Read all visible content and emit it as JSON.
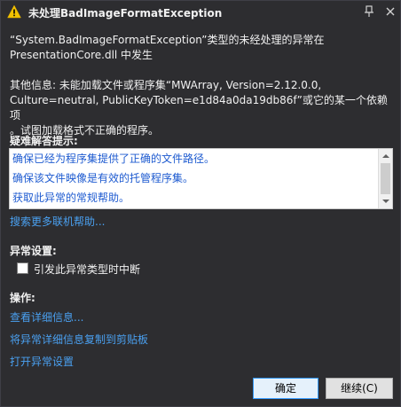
{
  "window": {
    "title": "未处理BadImageFormatException",
    "title_icon": "warning-icon",
    "pin_icon": "pin-icon",
    "close_icon": "close-icon"
  },
  "message": {
    "line1": "“System.BadImageFormatException”类型的未经处理的异常在",
    "line2": "PresentationCore.dll 中发生",
    "info_line1": "其他信息: 未能加载文件或程序集“MWArray, Version=2.12.0.0,",
    "info_line2": "Culture=neutral, PublicKeyToken=e1d84a0da19db86f”或它的某一个依赖项",
    "info_line3": "。试图加载格式不正确的程序。"
  },
  "troubleshooting": {
    "heading": "疑难解答提示:",
    "tips": [
      "确保已经为程序集提供了正确的文件路径。",
      "确保该文件映像是有效的托管程序集。",
      "获取此异常的常规帮助。"
    ],
    "online_help_link": "搜索更多联机帮助..."
  },
  "exception_settings": {
    "heading": "异常设置:",
    "break_checkbox_label": "引发此异常类型时中断",
    "break_checked": false
  },
  "actions": {
    "heading": "操作:",
    "links": [
      "查看详细信息...",
      "将异常详细信息复制到剪贴板",
      "打开异常设置"
    ]
  },
  "buttons": {
    "ok_label": "确定",
    "continue_label": "继续(C)"
  },
  "colors": {
    "background": "#2d2d30",
    "link": "#4aa0f0",
    "tip_link": "#1e5bd0",
    "warning": "#f2c200"
  }
}
